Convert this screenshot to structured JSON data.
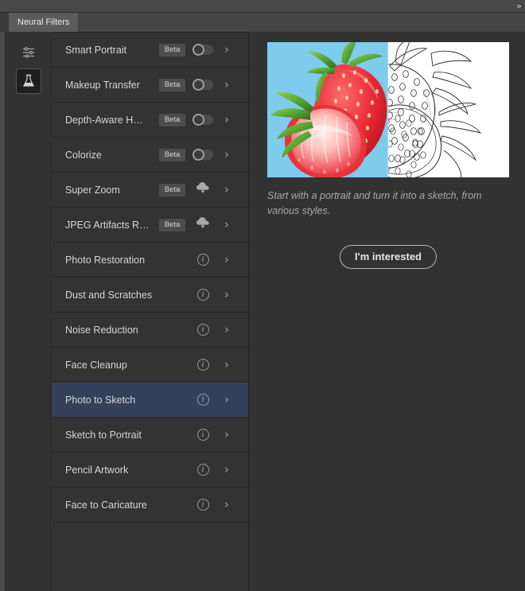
{
  "window": {
    "collapse_icon": "collapse-panel-icon",
    "collapse_glyph": "»"
  },
  "tab": {
    "label": "Neural Filters"
  },
  "sidebar": {
    "items": [
      {
        "name": "adjustment-sliders-icon",
        "selected": false
      },
      {
        "name": "beaker-flask-icon",
        "selected": true
      }
    ]
  },
  "filters": {
    "rows": [
      {
        "label": "Smart Portrait",
        "badge": "Beta",
        "status": "toggle-off",
        "selected": false
      },
      {
        "label": "Makeup Transfer",
        "badge": "Beta",
        "status": "toggle-off",
        "selected": false
      },
      {
        "label": "Depth-Aware H…",
        "badge": "Beta",
        "status": "toggle-off",
        "selected": false
      },
      {
        "label": "Colorize",
        "badge": "Beta",
        "status": "toggle-off",
        "selected": false
      },
      {
        "label": "Super Zoom",
        "badge": "Beta",
        "status": "cloud-download",
        "selected": false
      },
      {
        "label": "JPEG Artifacts R…",
        "badge": "Beta",
        "status": "cloud-download",
        "selected": false
      },
      {
        "label": "Photo Restoration",
        "badge": "",
        "status": "info",
        "selected": false
      },
      {
        "label": "Dust and Scratches",
        "badge": "",
        "status": "info",
        "selected": false
      },
      {
        "label": "Noise Reduction",
        "badge": "",
        "status": "info",
        "selected": false
      },
      {
        "label": "Face Cleanup",
        "badge": "",
        "status": "info",
        "selected": false
      },
      {
        "label": "Photo to Sketch",
        "badge": "",
        "status": "info",
        "selected": true
      },
      {
        "label": "Sketch to Portrait",
        "badge": "",
        "status": "info",
        "selected": false
      },
      {
        "label": "Pencil Artwork",
        "badge": "",
        "status": "info",
        "selected": false
      },
      {
        "label": "Face to Caricature",
        "badge": "",
        "status": "info",
        "selected": false
      }
    ],
    "chevron_glyph": "›",
    "info_glyph": "i"
  },
  "detail": {
    "preview_name": "photo-to-sketch-preview-image",
    "preview_alt": "Strawberry photo on left half, pencil sketch of strawberries on right half",
    "description": "Start with a portrait and turn it into a sketch, from various styles.",
    "cta_label": "I'm interested"
  },
  "colors": {
    "panel_bg": "#323232",
    "list_bg": "#333333",
    "tab_active": "#5b5b5b",
    "tabbar": "#454545",
    "selected_row": "#33425a",
    "row_divider": "#262626",
    "text_primary": "#d6d6d6",
    "text_muted": "#a9a9a9",
    "badge_bg": "#4d4d4d",
    "preview_sky": "#7ecbee",
    "preview_berry": "#e8323c",
    "preview_leaf": "#5aa934"
  }
}
